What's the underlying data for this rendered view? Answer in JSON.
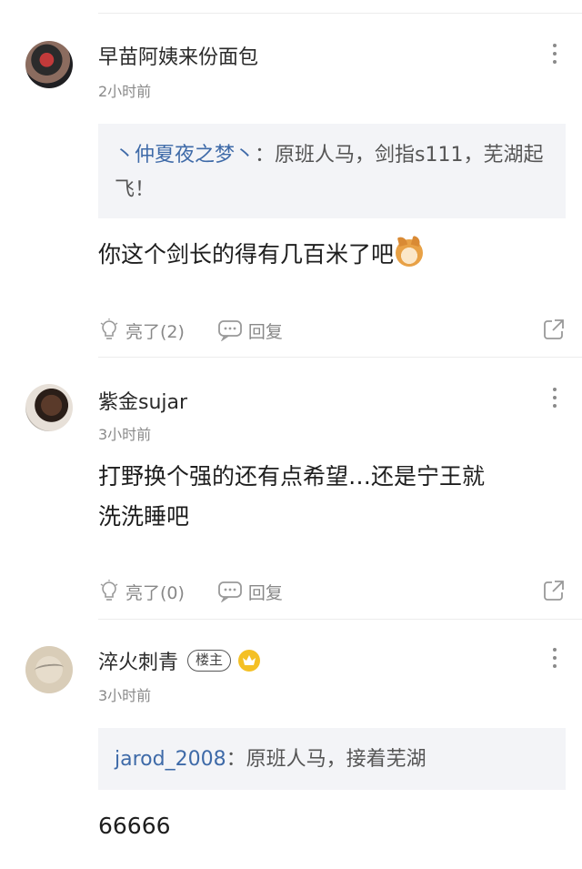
{
  "comments": [
    {
      "username": "早苗阿姨来份面包",
      "time": "2小时前",
      "quote": {
        "user": "丶仲夏夜之梦丶",
        "separator": "：",
        "text": "原班人马，剑指s111，芜湖起飞！"
      },
      "body": "你这个剑长的得有几百米了吧",
      "emoji": "dog-face-emoji",
      "like_label": "亮了(2)",
      "reply_label": "回复"
    },
    {
      "username": "紫金sujar",
      "time": "3小时前",
      "body_lines": [
        "打野换个强的还有点希望…还是宁王就",
        "洗洗睡吧"
      ],
      "like_label": "亮了(0)",
      "reply_label": "回复"
    },
    {
      "username": "淬火刺青",
      "owner_badge": "楼主",
      "time": "3小时前",
      "quote": {
        "user": "jarod_2008",
        "separator": "：",
        "text": "原班人马，接着芜湖"
      },
      "body": "66666"
    }
  ],
  "icons": {
    "like": "lightbulb-icon",
    "reply": "chat-bubble-icon",
    "share": "share-icon",
    "more": "more-vertical-icon",
    "crown": "crown-badge-icon"
  },
  "colors": {
    "quote_user": "#3e6aa8",
    "quote_bg": "#f3f4f7",
    "crown": "#f4c025"
  }
}
